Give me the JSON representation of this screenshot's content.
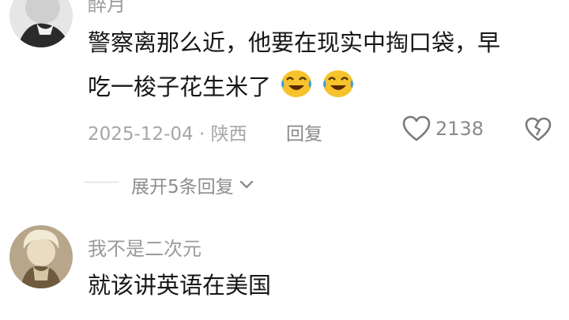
{
  "comments": [
    {
      "username": "醉月",
      "text_line1": "警察离那么近，他要在现实中掏口袋，早",
      "text_line2": "吃一梭子花生米了",
      "emoji": "crying-laughing-emoji",
      "date": "2025-12-04",
      "separator": "·",
      "location": "陕西",
      "reply_label": "回复",
      "likes": "2138",
      "expand_label": "展开5条回复"
    },
    {
      "username": "我不是二次元",
      "text": "就该讲英语在美国"
    }
  ],
  "colors": {
    "text": "#161616",
    "muted": "#a6a6a6",
    "icon": "#7a7a7a"
  }
}
